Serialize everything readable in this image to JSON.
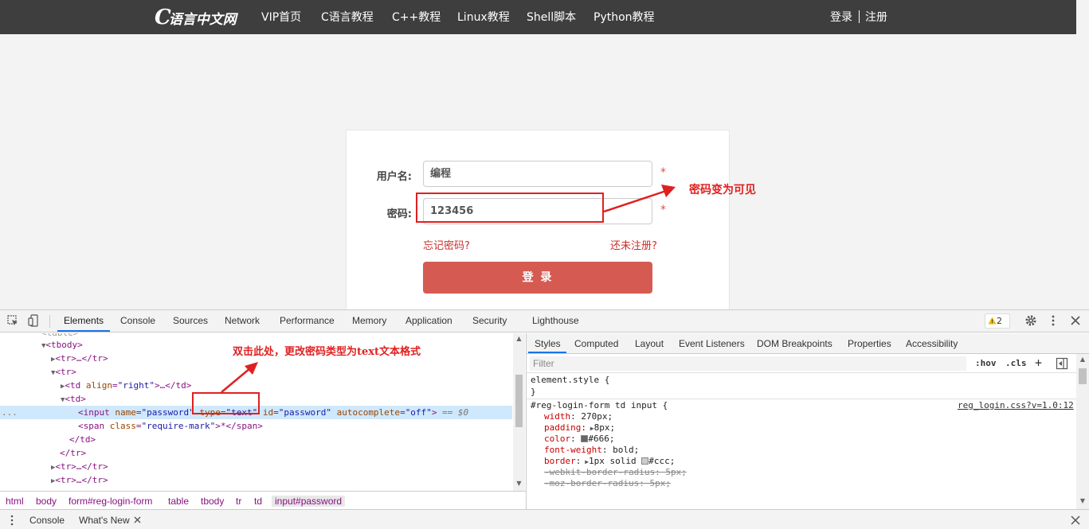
{
  "site": {
    "logo_text": "语言中文网",
    "logo_c": "C",
    "nav": [
      "VIP首页",
      "C语言教程",
      "C++教程",
      "Linux教程",
      "Shell脚本",
      "Python教程"
    ],
    "login_link": "登录",
    "register_link": "注册"
  },
  "login_form": {
    "username_label": "用户名:",
    "username_value": "编程",
    "password_label": "密码:",
    "password_value": "123456",
    "required_mark": "*",
    "forgot_link": "忘记密码?",
    "register_link": "还未注册?",
    "submit_label": "登 录"
  },
  "annotations": {
    "password_visible": "密码变为可见",
    "double_click_hint": "双击此处，更改密码类型为text文本格式"
  },
  "devtools": {
    "tabs": [
      "Elements",
      "Console",
      "Sources",
      "Network",
      "Performance",
      "Memory",
      "Application",
      "Security",
      "Lighthouse"
    ],
    "active_tab": "Elements",
    "warning_count": "2",
    "dom_lines": {
      "l0": "<table>",
      "l1_tag": "<tbody>",
      "l2": "<tr>…</tr>",
      "l3": "<tr>",
      "l4_open": "<td ",
      "l4_attr": "align",
      "l4_val": "\"right\"",
      "l4_close": ">…</td>",
      "l5": "<td>",
      "sel_open": "<input ",
      "sel_a1": "name",
      "sel_v1": "\"password\"",
      "sel_a2": "type",
      "sel_v2": "\"text\"",
      "sel_a3": "id",
      "sel_v3": "\"password\"",
      "sel_a4": "autocomplete",
      "sel_v4": "\"off\"",
      "sel_close": ">",
      "sel_eq": " == $0",
      "l7_open": "<span ",
      "l7_attr": "class",
      "l7_val": "\"require-mark\"",
      "l7_text": ">*</span>",
      "l8": "</td>",
      "l9": "</tr>",
      "l10": "<tr>…</tr>",
      "l11": "<tr>…</tr>",
      "ellipsis": "..."
    },
    "breadcrumbs": [
      "html",
      "body",
      "form#reg-login-form",
      "table",
      "tbody",
      "tr",
      "td",
      "input#password"
    ],
    "styles_tabs": [
      "Styles",
      "Computed",
      "Layout",
      "Event Listeners",
      "DOM Breakpoints",
      "Properties",
      "Accessibility"
    ],
    "filter_placeholder": "Filter",
    "hov": ":hov",
    "cls": ".cls",
    "plus": "+",
    "element_style_open": "element.style {",
    "close_brace": "}",
    "rule_selector": "#reg-login-form td input {",
    "rule_source": "reg_login.css?v=1.0:12",
    "props": [
      {
        "name": "width",
        "value": "270px;"
      },
      {
        "name": "padding",
        "value": "8px;"
      },
      {
        "name": "color",
        "value": "#666;"
      },
      {
        "name": "font-weight",
        "value": "bold;"
      },
      {
        "name": "border",
        "value": "1px solid",
        "value2": "#ccc;"
      },
      {
        "name": "-webkit-border-radius",
        "value": "5px;"
      },
      {
        "name": "-moz-border-radius",
        "value": "5px;"
      }
    ],
    "colors": {
      "swatch_666": "#666666",
      "swatch_ccc": "#cccccc"
    },
    "drawer_tabs": [
      "Console",
      "What's New"
    ]
  }
}
